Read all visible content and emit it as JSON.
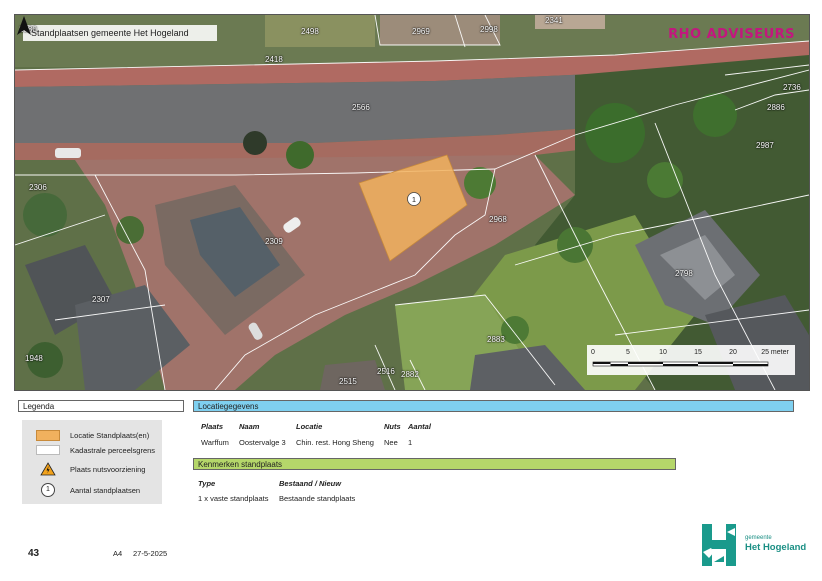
{
  "map": {
    "title": "Standplaatsen gemeente Het Hogeland",
    "brand": "RHO ADVISEURS",
    "marker_number": "1",
    "parcel_labels": [
      {
        "id": "p2498",
        "text": "2498"
      },
      {
        "id": "p2969",
        "text": "2969"
      },
      {
        "id": "p2998",
        "text": "2998"
      },
      {
        "id": "p2341",
        "text": "2341"
      },
      {
        "id": "p2418",
        "text": "2418"
      },
      {
        "id": "p2566",
        "text": "2566"
      },
      {
        "id": "p2736",
        "text": "2736"
      },
      {
        "id": "p2886",
        "text": "2886"
      },
      {
        "id": "p2987",
        "text": "2987"
      },
      {
        "id": "p2306",
        "text": "2306"
      },
      {
        "id": "p2968",
        "text": "2968"
      },
      {
        "id": "p2309",
        "text": "2309"
      },
      {
        "id": "p2798",
        "text": "2798"
      },
      {
        "id": "p2307",
        "text": "2307"
      },
      {
        "id": "p2883",
        "text": "2883"
      },
      {
        "id": "p1948",
        "text": "1948"
      },
      {
        "id": "p2515",
        "text": "2515"
      },
      {
        "id": "p2516",
        "text": "2516"
      },
      {
        "id": "p2882",
        "text": "2882"
      },
      {
        "id": "p2380",
        "text": "2380"
      }
    ],
    "scale": {
      "ticks": [
        "0",
        "5",
        "10",
        "15",
        "20",
        "25 meter"
      ],
      "values_m": [
        0,
        5,
        10,
        15,
        20,
        25
      ]
    }
  },
  "legend": {
    "title": "Legenda",
    "items": [
      {
        "label": "Locatie Standplaats(en)",
        "symbol": "orange-area"
      },
      {
        "label": "Kadastrale perceelsgrens",
        "symbol": "white-outline"
      },
      {
        "label": "Plaats nutsvoorziening",
        "symbol": "warning-triangle"
      },
      {
        "label": "Aantal standplaatsen",
        "symbol": "number-circle",
        "symbol_text": "1"
      }
    ]
  },
  "locatiegegevens": {
    "title": "Locatiegegevens",
    "headers": [
      "Plaats",
      "Naam",
      "Locatie",
      "Nuts",
      "Aantal"
    ],
    "row": [
      "Warffum",
      "Oostervalge 3",
      "Chin. rest. Hong Sheng",
      "Nee",
      "1"
    ]
  },
  "kenmerken": {
    "title": "Kenmerken standplaats",
    "headers": [
      "Type",
      "Bestaand / Nieuw"
    ],
    "row": [
      "1 x vaste standplaats",
      "Bestaande standplaats"
    ]
  },
  "footer": {
    "page_number": "43",
    "paper": "A4",
    "date": "27-5-2025",
    "gemeente_small": "gemeente",
    "gemeente_name": "Het Hogeland"
  },
  "colors": {
    "standplaats_fill": "#f1b15e",
    "locatie_header": "#7fd0f0",
    "kenmerken_header": "#b5d76a",
    "brand": "#c2177e",
    "gemeente": "#1a8f84"
  }
}
